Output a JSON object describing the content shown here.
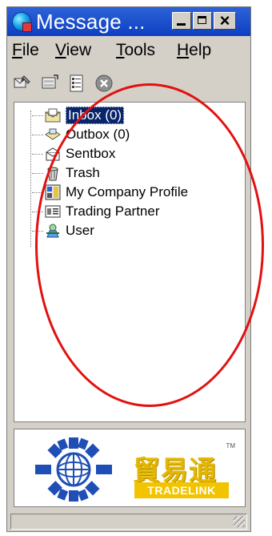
{
  "window": {
    "title": "Message ...",
    "controls": [
      "minimize",
      "maximize",
      "close"
    ]
  },
  "menu": {
    "items": [
      "File",
      "View",
      "Tools",
      "Help"
    ]
  },
  "toolbar": {
    "buttons": [
      "new-message-icon",
      "receive-icon",
      "list-icon",
      "stop-icon"
    ]
  },
  "tree": {
    "items": [
      {
        "label": "Inbox (0)",
        "icon": "inbox-icon",
        "selected": true
      },
      {
        "label": "Outbox (0)",
        "icon": "outbox-icon",
        "selected": false
      },
      {
        "label": "Sentbox",
        "icon": "sentbox-icon",
        "selected": false
      },
      {
        "label": "Trash",
        "icon": "trash-icon",
        "selected": false
      },
      {
        "label": "My Company Profile",
        "icon": "company-profile-icon",
        "selected": false
      },
      {
        "label": "Trading Partner",
        "icon": "trading-partner-icon",
        "selected": false
      },
      {
        "label": "User",
        "icon": "user-icon",
        "selected": false
      }
    ]
  },
  "logo": {
    "chinese": "貿易通",
    "english": "TRADELINK",
    "tm": "TM"
  },
  "colors": {
    "titlebar": "#0d3ec0",
    "selection": "#0a246a",
    "annotation": "#e31010",
    "logo_gold": "#e4b800",
    "logo_blue": "#1f4fb6"
  }
}
